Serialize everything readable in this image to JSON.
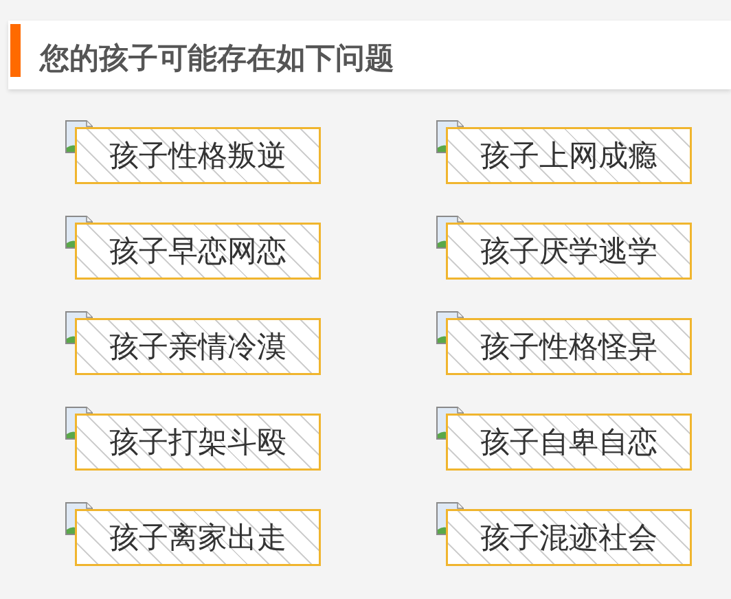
{
  "header": {
    "title": "您的孩子可能存在如下问题"
  },
  "problems": [
    {
      "label": "孩子性格叛逆"
    },
    {
      "label": "孩子上网成瘾"
    },
    {
      "label": "孩子早恋网恋"
    },
    {
      "label": "孩子厌学逃学"
    },
    {
      "label": "孩子亲情冷漠"
    },
    {
      "label": "孩子性格怪异"
    },
    {
      "label": "孩子打架斗殴"
    },
    {
      "label": "孩子自卑自恋"
    },
    {
      "label": "孩子离家出走"
    },
    {
      "label": "孩子混迹社会"
    }
  ]
}
